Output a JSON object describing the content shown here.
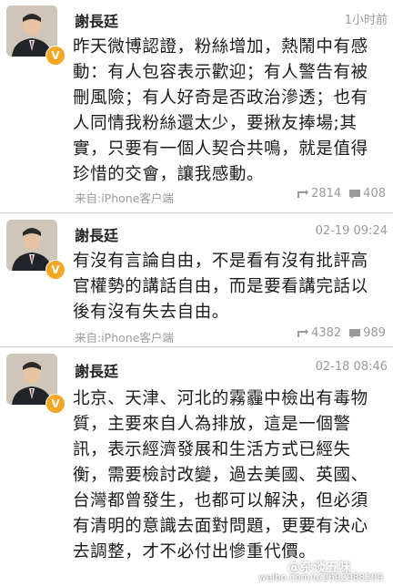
{
  "posts": [
    {
      "author": "謝長廷",
      "time": "1小时前",
      "text": "昨天微博認證，粉絲增加，熱鬧中有感動：有人包容表示歡迎；有人警告有被刪風險；有人好奇是否政治滲透；也有人同情我粉絲還太少，要揪友捧場;其實，只要有一個人契合共鳴，就是值得珍惜的交會，讓我感動。",
      "source": "来自:iPhone客户端",
      "reposts": "2814",
      "comments": "408"
    },
    {
      "author": "謝長廷",
      "time": "02-19 09:24",
      "text": "有沒有言論自由，不是看有沒有批評高官權勢的講話自由，而是要看講完話以後有沒有失去自由。",
      "source": "来自:iPhone客户端",
      "reposts": "4382",
      "comments": "989"
    },
    {
      "author": "謝長廷",
      "time": "02-18 08:46",
      "text": "北京、天津、河北的霧霾中檢出有毒物質，主要來自人為排放，這是一個警訊，表示經濟發展和生活方式已經失衡，需要檢討改變，過去美國、英國、台灣都曾發生，也都可以解決，但必須有清明的意識去面對問題，更要有決心去調整，才不必付出慘重代價。"
    }
  ],
  "watermark": {
    "label": "@杂谈五味",
    "url": "weibo.com/u/2692988209"
  },
  "colors": {
    "verified_badge": "#f5a623",
    "muted_text": "#9a9a9a"
  },
  "icons": [
    "verified-badge-icon",
    "repost-icon",
    "comment-icon"
  ]
}
